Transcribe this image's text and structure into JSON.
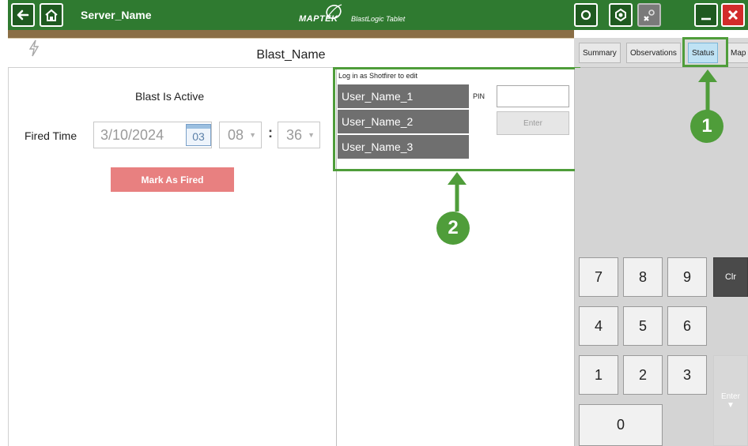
{
  "titlebar": {
    "server_name": "Server_Name",
    "brand_mark": "MAPTEK",
    "brand_product": "BlastLogic Tablet",
    "icons": [
      "back-arrow-icon",
      "home-icon",
      "refresh-icon",
      "sync-icon",
      "settings-disabled-icon",
      "minimize-icon",
      "close-icon"
    ]
  },
  "header": {
    "blast_name": "Blast_Name",
    "icon": "lightning-icon"
  },
  "tabs": [
    {
      "label": "Summary"
    },
    {
      "label": "Observations"
    },
    {
      "label": "Status",
      "active": true
    },
    {
      "label": "Map"
    }
  ],
  "status": {
    "blast_state": "Blast Is Active",
    "fired_time_label": "Fired Time",
    "date_value": "3/10/2024",
    "calendar_day": "03",
    "hour": "08",
    "minute": "36",
    "mark_button": "Mark As Fired"
  },
  "login": {
    "hint": "Log in as Shotfirer to edit",
    "users": [
      "User_Name_1",
      "User_Name_2",
      "User_Name_3"
    ],
    "pin_label": "PIN",
    "pin_value": "",
    "enter_button": "Enter"
  },
  "keypad": {
    "rows": [
      [
        "7",
        "8",
        "9"
      ],
      [
        "4",
        "5",
        "6"
      ],
      [
        "1",
        "2",
        "3"
      ]
    ],
    "zero": "0",
    "clear": "Clr",
    "enter": "Enter"
  },
  "annotations": {
    "badge_1": "1",
    "badge_2": "2"
  },
  "colors": {
    "titlebar": "#2f7a30",
    "annotation": "#4f9d3a",
    "mark_button": "#e88080",
    "active_tab": "#bfe2f4"
  }
}
